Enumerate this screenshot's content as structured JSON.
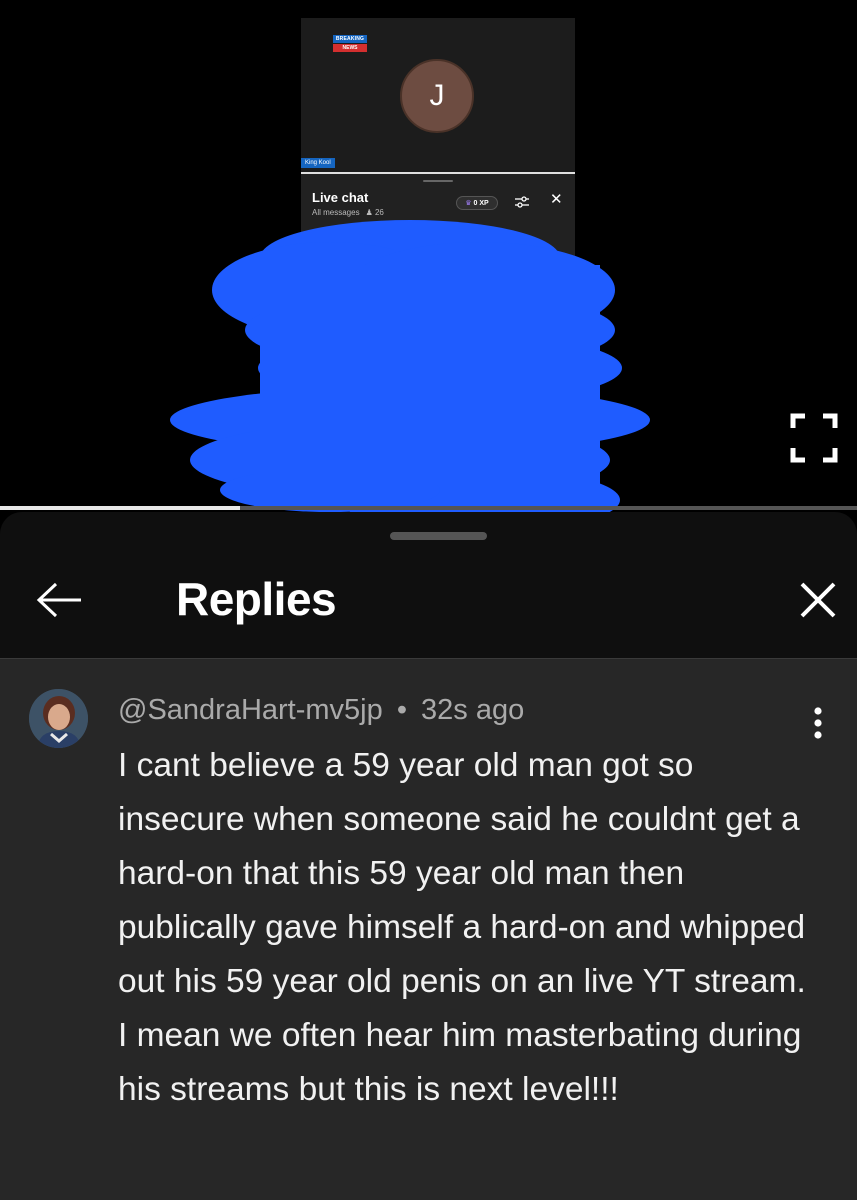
{
  "stream": {
    "breaking_top": "BREAKING",
    "breaking_bottom": "NEWS",
    "avatar_initial": "J",
    "channel_tag": "King Kool"
  },
  "live_chat": {
    "title": "Live chat",
    "filter_label": "All messages",
    "viewer_count": "26",
    "xp_label": "0 XP"
  },
  "video": {
    "progress_fraction": 0.28
  },
  "replies": {
    "title": "Replies"
  },
  "comment": {
    "author": "@SandraHart-mv5jp",
    "separator": "•",
    "time": "32s ago",
    "text": "I cant believe a 59 year old man got so insecure when someone said he couldnt get a hard-on that this 59 year old man then publically gave himself a hard-on and whipped out his 59 year old penis on an live YT stream. I mean we often hear him masterbating during his streams but this is next level!!!"
  },
  "colors": {
    "redaction": "#1f5cff",
    "panel_bg": "#0f0f0f",
    "comment_bg": "#272727"
  }
}
